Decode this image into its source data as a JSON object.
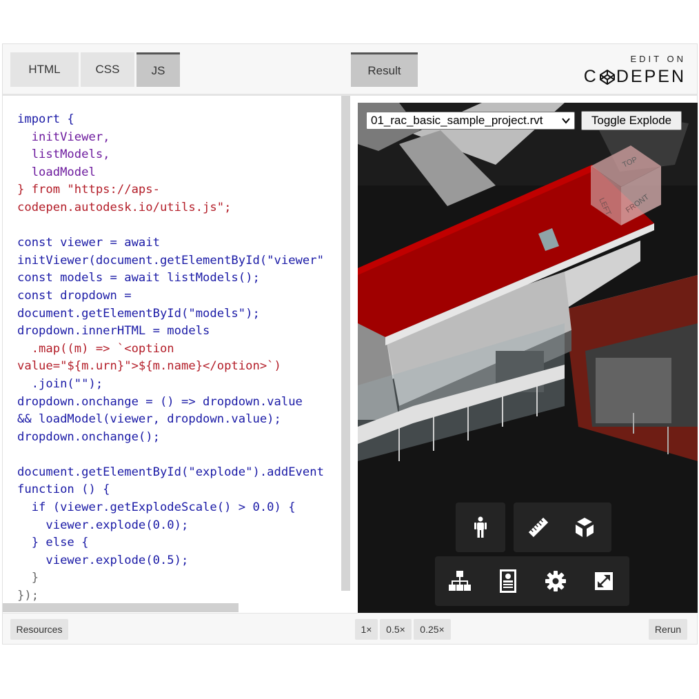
{
  "header": {
    "tabs": [
      {
        "label": "HTML"
      },
      {
        "label": "CSS"
      },
      {
        "label": "JS"
      }
    ],
    "result_tab": "Result",
    "brand_top": "EDIT ON",
    "brand_left": "C",
    "brand_right": "DEPEN"
  },
  "code": {
    "lines": [
      "import {",
      "  initViewer,",
      "  listModels,",
      "  loadModel",
      "} from \"https://aps-",
      "codepen.autodesk.io/utils.js\";",
      "",
      "const viewer = await",
      "initViewer(document.getElementById(\"viewer\"",
      "const models = await listModels();",
      "const dropdown =",
      "document.getElementById(\"models\");",
      "dropdown.innerHTML = models",
      "  .map((m) => `<option",
      "value=\"${m.urn}\">${m.name}</option>`)",
      "  .join(\"\");",
      "dropdown.onchange = () => dropdown.value",
      "&& loadModel(viewer, dropdown.value);",
      "dropdown.onchange();",
      "",
      "document.getElementById(\"explode\").addEvent",
      "function () {",
      "  if (viewer.getExplodeScale() > 0.0) {",
      "    viewer.explode(0.0);",
      "  } else {",
      "    viewer.explode(0.5);",
      "  }",
      "});"
    ]
  },
  "result": {
    "model_select_value": "01_rac_basic_sample_project.rvt",
    "explode_button": "Toggle Explode",
    "viewcube_faces": [
      "TOP",
      "LEFT",
      "FRONT"
    ],
    "toolbar_icons": [
      "person-icon",
      "ruler-icon",
      "cube-explode-icon",
      "model-tree-icon",
      "properties-icon",
      "settings-gear-icon",
      "fullscreen-icon"
    ]
  },
  "footer": {
    "resources": "Resources",
    "zoom_1x": "1×",
    "zoom_05x": "0.5×",
    "zoom_025x": "0.25×",
    "rerun": "Rerun"
  },
  "colors": {
    "roof": "#a00000",
    "viewer_bg": "#111111",
    "toolbar_bg": "#262626"
  }
}
